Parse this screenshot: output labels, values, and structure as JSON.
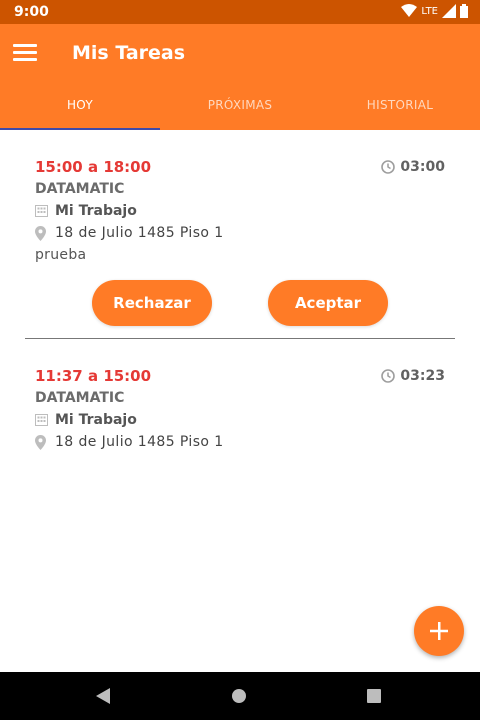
{
  "status_bar": {
    "time": "9:00",
    "network": "LTE"
  },
  "header": {
    "title": "Mis Tareas"
  },
  "tabs": [
    {
      "label": "HOY"
    },
    {
      "label": "PRÓXIMAS"
    },
    {
      "label": "HISTORIAL"
    }
  ],
  "tasks": [
    {
      "time_range": "15:00 a 18:00",
      "duration": "03:00",
      "company": "DATAMATIC",
      "workplace": "Mi Trabajo",
      "address": "18 de Julio 1485 Piso 1",
      "note": "prueba",
      "reject_label": "Rechazar",
      "accept_label": "Aceptar"
    },
    {
      "time_range": "11:37 a 15:00",
      "duration": "03:23",
      "company": "DATAMATIC",
      "workplace": "Mi Trabajo",
      "address": "18 de Julio 1485 Piso 1"
    }
  ],
  "colors": {
    "accent": "#ff7b26",
    "status_bar": "#cc5400",
    "time_red": "#e53935",
    "tab_indicator": "#3f4aa8"
  }
}
